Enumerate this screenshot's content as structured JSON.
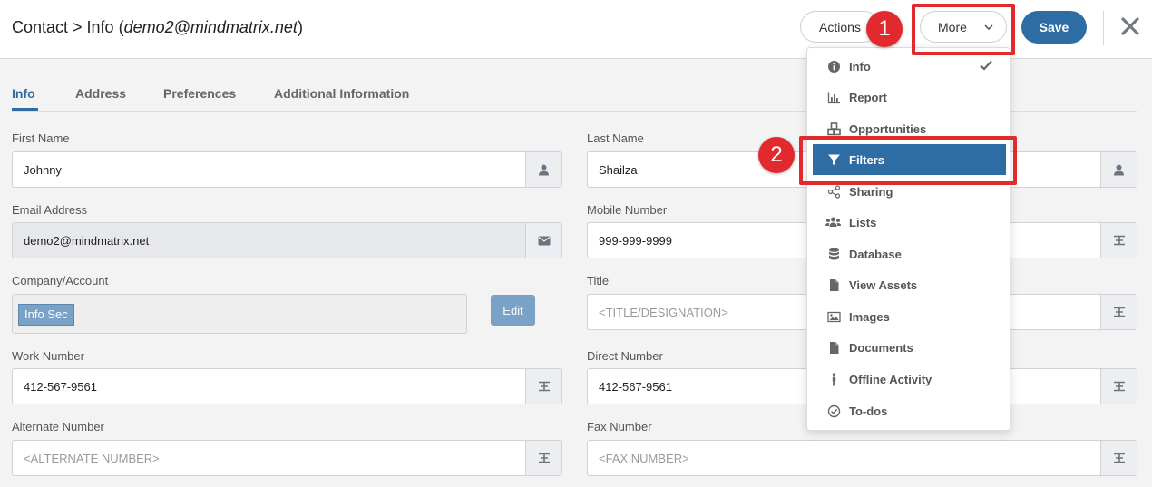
{
  "header": {
    "title_prefix": "Contact > Info (",
    "title_email": "demo2@mindmatrix.net",
    "title_suffix": ")",
    "actions_label": "Actions",
    "more_label": "More",
    "save_label": "Save"
  },
  "tabs": [
    {
      "label": "Info"
    },
    {
      "label": "Address"
    },
    {
      "label": "Preferences"
    },
    {
      "label": "Additional Information"
    }
  ],
  "form": {
    "first_name": {
      "label": "First Name",
      "value": "Johnny"
    },
    "last_name": {
      "label": "Last Name",
      "value": "Shailza"
    },
    "email": {
      "label": "Email Address",
      "value": "demo2@mindmatrix.net"
    },
    "mobile": {
      "label": "Mobile Number",
      "value": "999-999-9999"
    },
    "company": {
      "label": "Company/Account",
      "chip": "Info Sec",
      "edit_label": "Edit"
    },
    "title": {
      "label": "Title",
      "placeholder": "<TITLE/DESIGNATION>"
    },
    "work": {
      "label": "Work Number",
      "value": "412-567-9561"
    },
    "direct": {
      "label": "Direct Number",
      "value": "412-567-9561"
    },
    "alternate": {
      "label": "Alternate Number",
      "placeholder": "<ALTERNATE NUMBER>"
    },
    "fax": {
      "label": "Fax Number",
      "placeholder": "<FAX NUMBER>"
    }
  },
  "menu": {
    "items": [
      {
        "label": "Info",
        "icon": "info-icon"
      },
      {
        "label": "Report",
        "icon": "bar-chart-icon"
      },
      {
        "label": "Opportunities",
        "icon": "cubes-icon"
      },
      {
        "label": "Filters",
        "icon": "filter-icon"
      },
      {
        "label": "Sharing",
        "icon": "share-icon"
      },
      {
        "label": "Lists",
        "icon": "users-icon"
      },
      {
        "label": "Database",
        "icon": "database-icon"
      },
      {
        "label": "View Assets",
        "icon": "file-icon"
      },
      {
        "label": "Images",
        "icon": "image-icon"
      },
      {
        "label": "Documents",
        "icon": "document-icon"
      },
      {
        "label": "Offline Activity",
        "icon": "person-icon"
      },
      {
        "label": "To-dos",
        "icon": "check-circle-icon"
      }
    ]
  },
  "annotations": {
    "step1": "1",
    "step2": "2"
  },
  "colors": {
    "accent": "#2e6da4",
    "highlight": "#e2292d"
  }
}
